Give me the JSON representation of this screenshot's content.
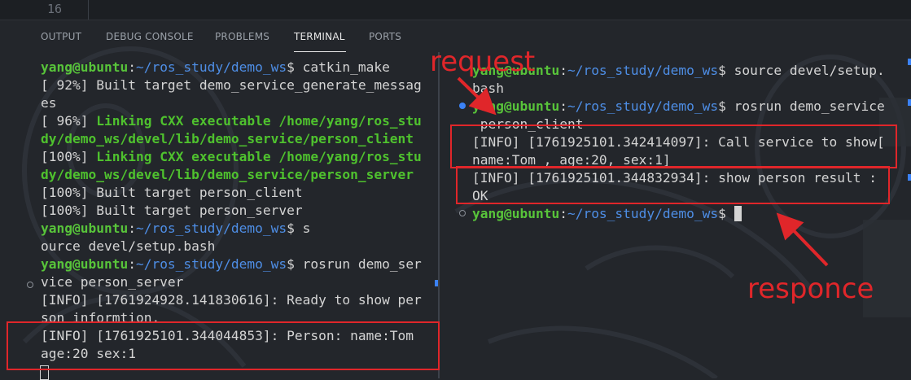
{
  "editor": {
    "line_number": "16"
  },
  "panel": {
    "tabs": [
      {
        "label": "OUTPUT"
      },
      {
        "label": "DEBUG CONSOLE"
      },
      {
        "label": "PROBLEMS"
      },
      {
        "label": "TERMINAL"
      },
      {
        "label": "PORTS"
      }
    ],
    "active_tab": "TERMINAL"
  },
  "prompt": {
    "user": "yang@ubuntu",
    "sep": ":",
    "path": "~/ros_study/demo_ws",
    "symbol": "$"
  },
  "left_terminal": {
    "cmd1": " catkin_make",
    "l2": "[ 92%] Built target demo_service_generate_messag",
    "l3": "es",
    "l4_prefix": "[ 96%] ",
    "l4_green": "Linking CXX executable /home/yang/ros_stu",
    "l5": "dy/demo_ws/devel/lib/demo_service/person_client",
    "l6_prefix": "[100%] ",
    "l6_green": "Linking CXX executable /home/yang/ros_stu",
    "l7": "dy/demo_ws/devel/lib/demo_service/person_server",
    "l8": "[100%] Built target person_client",
    "l9": "[100%] Built target person_server",
    "cmd10": " s",
    "l11": "ource devel/setup.bash",
    "cmd12": " rosrun demo_ser",
    "l13": "vice person_server",
    "l14": "[INFO] [1761924928.141830616]: Ready to show per",
    "l15": "son informtion.",
    "l16": "[INFO] [1761925101.344044853]: Person: name:Tom",
    "l17": "age:20 sex:1"
  },
  "right_terminal": {
    "cmd1": " source devel/setup.",
    "l2": "bash",
    "cmd3": " rosrun demo_service",
    "l4": " person_client",
    "l5": "[INFO] [1761925101.342414097]: Call service to show[",
    "l6": "name:Tom , age:20, sex:1]",
    "l7": "[INFO] [1761925101.344832934]: show person result :",
    "l8": "OK"
  },
  "annotations": {
    "request": "request",
    "response": "responce",
    "color": "#e0262a"
  }
}
